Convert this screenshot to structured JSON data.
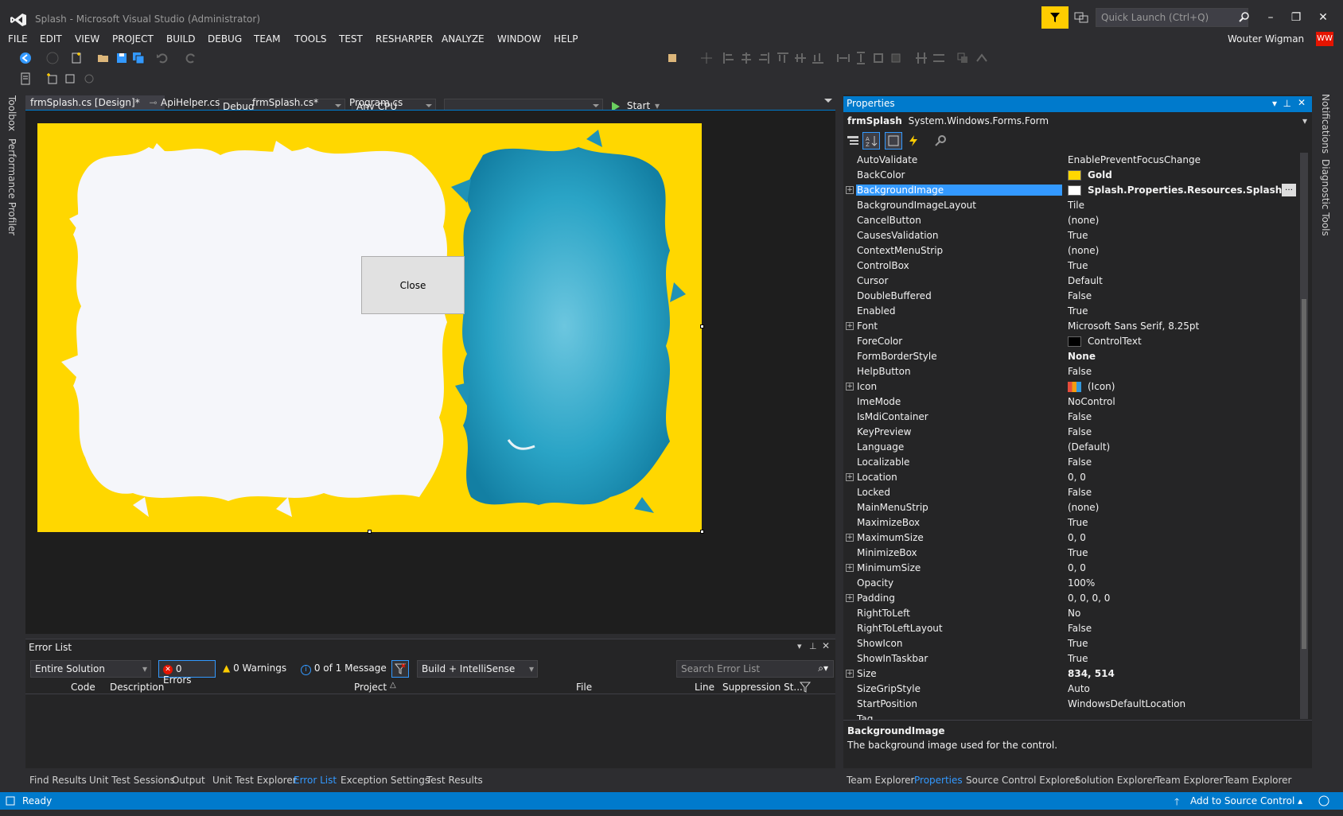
{
  "window": {
    "title": "Splash - Microsoft Visual Studio  (Administrator)",
    "quick_launch_placeholder": "Quick Launch (Ctrl+Q)",
    "user": "Wouter Wigman",
    "user_initials": "WW"
  },
  "menu": [
    "FILE",
    "EDIT",
    "VIEW",
    "PROJECT",
    "BUILD",
    "DEBUG",
    "TEAM",
    "TOOLS",
    "TEST",
    "RESHARPER",
    "ANALYZE",
    "WINDOW",
    "HELP"
  ],
  "toolbar": {
    "config": "Debug",
    "platform": "Any CPU",
    "startup": "",
    "start_label": "Start"
  },
  "left_strip": [
    "Toolbox",
    "Performance Profiler"
  ],
  "right_strip": [
    "Notifications",
    "Diagnostic Tools"
  ],
  "doc_tabs": [
    {
      "label": "frmSplash.cs [Design]*",
      "active": true
    },
    {
      "label": "ApiHelper.cs",
      "active": false
    },
    {
      "label": "frmSplash.cs*",
      "active": false
    },
    {
      "label": "Program.cs",
      "active": false
    }
  ],
  "designer": {
    "form_button_label": "Close"
  },
  "error_list": {
    "title": "Error List",
    "scope": "Entire Solution",
    "errors": "0 Errors",
    "warnings": "0 Warnings",
    "messages": "0 of 1 Message",
    "build_filter": "Build + IntelliSense",
    "search_placeholder": "Search Error List",
    "columns": [
      "Code",
      "Description",
      "Project",
      "File",
      "Line",
      "Suppression St..."
    ]
  },
  "bottom_tabs_left": [
    {
      "label": "Find Results",
      "active": false
    },
    {
      "label": "Unit Test Sessions",
      "active": false
    },
    {
      "label": "Output",
      "active": false
    },
    {
      "label": "Unit Test Explorer",
      "active": false
    },
    {
      "label": "Error List",
      "active": true
    },
    {
      "label": "Exception Settings",
      "active": false
    },
    {
      "label": "Test Results",
      "active": false
    }
  ],
  "bottom_tabs_right": [
    {
      "label": "Team Explorer",
      "active": false
    },
    {
      "label": "Properties",
      "active": true
    },
    {
      "label": "Source Control Explorer",
      "active": false
    },
    {
      "label": "Solution Explorer",
      "active": false
    },
    {
      "label": "Team Explorer",
      "active": false
    },
    {
      "label": "Team Explorer",
      "active": false
    }
  ],
  "properties": {
    "title": "Properties",
    "object_name": "frmSplash",
    "object_type": "System.Windows.Forms.Form",
    "rows": [
      {
        "name": "AutoValidate",
        "value": "EnablePreventFocusChange"
      },
      {
        "name": "BackColor",
        "value": "Gold",
        "bold": true,
        "swatch": "#ffd700"
      },
      {
        "name": "BackgroundImage",
        "value": "Splash.Properties.Resources.Splash",
        "bold": true,
        "selected": true,
        "expand": true,
        "swatch": "#ffffff"
      },
      {
        "name": "BackgroundImageLayout",
        "value": "Tile"
      },
      {
        "name": "CancelButton",
        "value": "(none)"
      },
      {
        "name": "CausesValidation",
        "value": "True"
      },
      {
        "name": "ContextMenuStrip",
        "value": "(none)"
      },
      {
        "name": "ControlBox",
        "value": "True"
      },
      {
        "name": "Cursor",
        "value": "Default"
      },
      {
        "name": "DoubleBuffered",
        "value": "False"
      },
      {
        "name": "Enabled",
        "value": "True"
      },
      {
        "name": "Font",
        "value": "Microsoft Sans Serif, 8.25pt",
        "expand": true
      },
      {
        "name": "ForeColor",
        "value": "ControlText",
        "swatch": "#000000"
      },
      {
        "name": "FormBorderStyle",
        "value": "None",
        "bold": true
      },
      {
        "name": "HelpButton",
        "value": "False"
      },
      {
        "name": "Icon",
        "value": "(Icon)",
        "expand": true,
        "swatch": "icon"
      },
      {
        "name": "ImeMode",
        "value": "NoControl"
      },
      {
        "name": "IsMdiContainer",
        "value": "False"
      },
      {
        "name": "KeyPreview",
        "value": "False"
      },
      {
        "name": "Language",
        "value": "(Default)"
      },
      {
        "name": "Localizable",
        "value": "False"
      },
      {
        "name": "Location",
        "value": "0, 0",
        "expand": true
      },
      {
        "name": "Locked",
        "value": "False"
      },
      {
        "name": "MainMenuStrip",
        "value": "(none)"
      },
      {
        "name": "MaximizeBox",
        "value": "True"
      },
      {
        "name": "MaximumSize",
        "value": "0, 0",
        "expand": true
      },
      {
        "name": "MinimizeBox",
        "value": "True"
      },
      {
        "name": "MinimumSize",
        "value": "0, 0",
        "expand": true
      },
      {
        "name": "Opacity",
        "value": "100%"
      },
      {
        "name": "Padding",
        "value": "0, 0, 0, 0",
        "expand": true
      },
      {
        "name": "RightToLeft",
        "value": "No"
      },
      {
        "name": "RightToLeftLayout",
        "value": "False"
      },
      {
        "name": "ShowIcon",
        "value": "True"
      },
      {
        "name": "ShowInTaskbar",
        "value": "True"
      },
      {
        "name": "Size",
        "value": "834, 514",
        "bold": true,
        "expand": true
      },
      {
        "name": "SizeGripStyle",
        "value": "Auto"
      },
      {
        "name": "StartPosition",
        "value": "WindowsDefaultLocation"
      },
      {
        "name": "Tag",
        "value": ""
      }
    ],
    "desc_title": "BackgroundImage",
    "desc_text": "The background image used for the control."
  },
  "status": {
    "text": "Ready",
    "source_control": "Add to Source Control"
  },
  "colors": {
    "accent": "#007acc",
    "form_back": "#ffd700",
    "splash_blue": "#1a9fc0"
  }
}
